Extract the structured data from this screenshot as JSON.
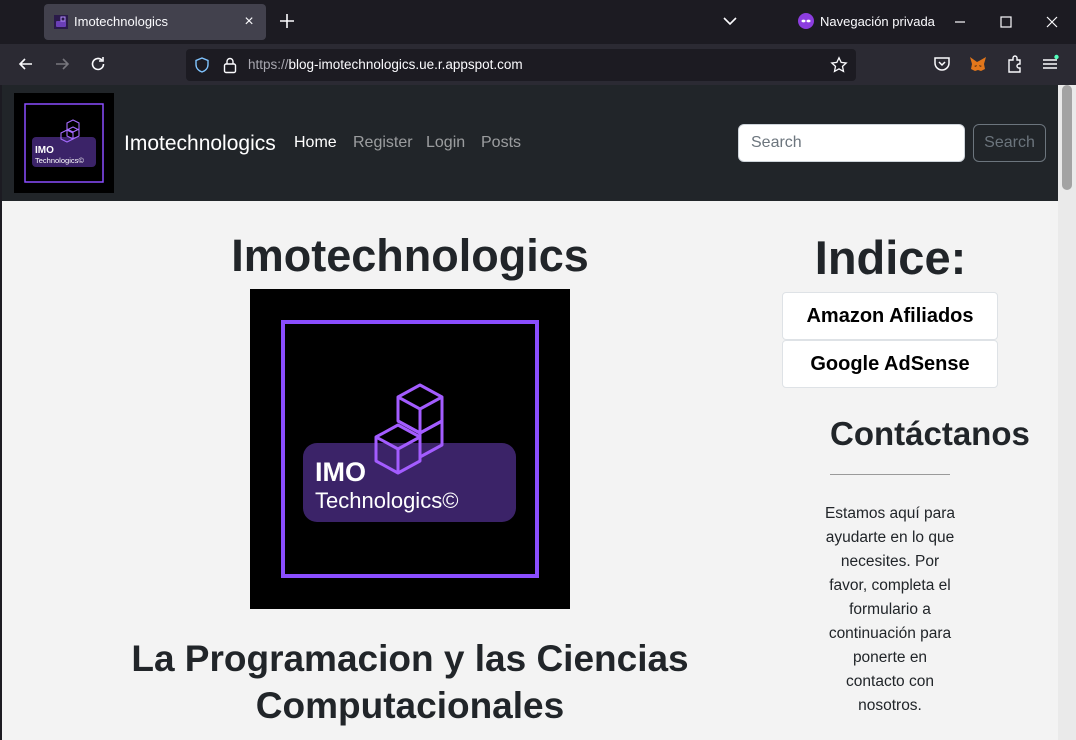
{
  "browser": {
    "tab_title": "Imotechnologics",
    "private_label": "Navegación privada",
    "url_scheme": "https://",
    "url_host": "blog-imotechnologics.ue.r.appspot.com"
  },
  "site": {
    "brand": "Imotechnologics",
    "nav": [
      {
        "label": "Home"
      },
      {
        "label": "Register"
      },
      {
        "label": "Login"
      },
      {
        "label": "Posts"
      }
    ],
    "search_placeholder": "Search",
    "search_button": "Search",
    "logo_text_line1": "IMO",
    "logo_text_line2": "Technologics©"
  },
  "main": {
    "title": "Imotechnologics",
    "subtitle": "La Programacion y las Ciencias Computacionales"
  },
  "sidebar": {
    "indice_title": "Indice:",
    "links": [
      {
        "label": "Amazon Afiliados"
      },
      {
        "label": "Google AdSense"
      }
    ],
    "contact_title": "Contáctanos",
    "contact_text": "Estamos aquí para ayudarte en lo que necesites. Por favor, completa el formulario a continuación para ponerte en contacto con nosotros."
  },
  "colors": {
    "accent_purple": "#8a4dff",
    "navbar_bg": "#212529",
    "page_bg": "#f3f3f3"
  }
}
